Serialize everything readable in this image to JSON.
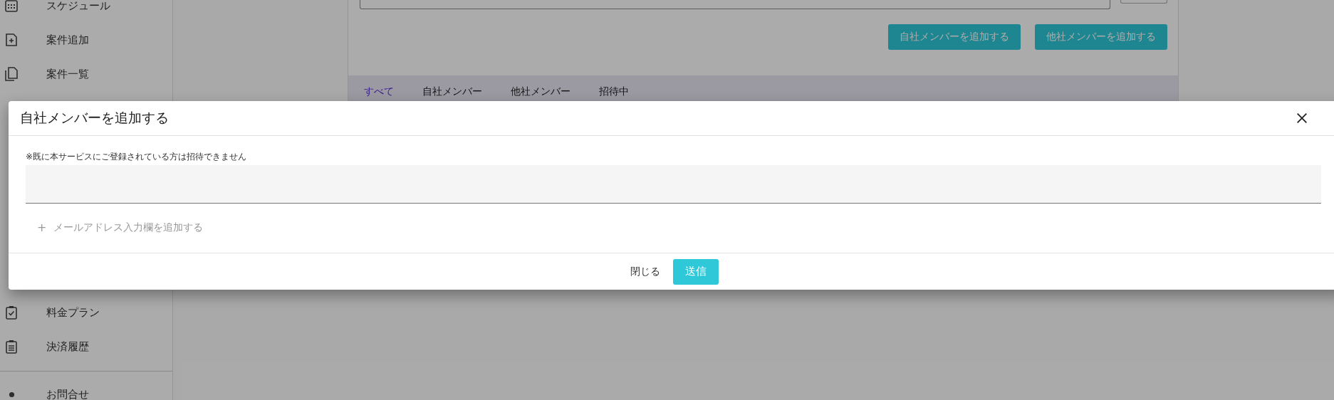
{
  "sidebar": {
    "items": [
      {
        "label": "スケジュール",
        "kind": "calendar"
      },
      {
        "label": "案件追加",
        "kind": "add-doc"
      },
      {
        "label": "案件一覧",
        "kind": "docs"
      }
    ],
    "lower_items": [
      {
        "label": "料金プラン",
        "kind": "clipboard-check"
      },
      {
        "label": "決済履歴",
        "kind": "clipboard-list"
      }
    ],
    "footer_items": [
      {
        "label": "お問合せ",
        "kind": "dot"
      }
    ]
  },
  "member_buttons": [
    "自社メンバーを追加する",
    "他社メンバーを追加する"
  ],
  "tabs": [
    {
      "label": "すべて",
      "selected": true
    },
    {
      "label": "自社メンバー",
      "selected": false
    },
    {
      "label": "他社メンバー",
      "selected": false
    },
    {
      "label": "招待中",
      "selected": false
    }
  ],
  "dialog": {
    "title": "自社メンバーを追加する",
    "note": "※既に本サービスにご登録されている方は招待できません",
    "add_field_icon": "+",
    "add_field_label": "メールアドレス入力欄を追加する",
    "buttons": [
      {
        "label": "閉じる",
        "kind": "text"
      },
      {
        "label": "送信",
        "kind": "primary"
      }
    ]
  }
}
